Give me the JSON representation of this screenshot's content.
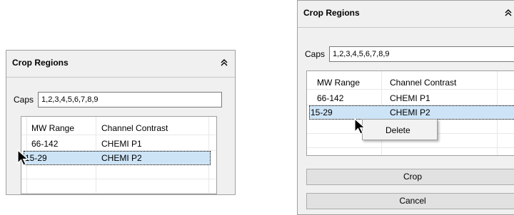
{
  "left_panel": {
    "title": "Crop Regions",
    "collapse_icon": "double-chevron-up-icon",
    "caps_label": "Caps",
    "caps_value": "1,2,3,4,5,6,7,8,9",
    "columns": [
      "MW Range",
      "Channel Contrast"
    ],
    "rows": [
      [
        "66-142",
        "CHEMI P1"
      ],
      [
        "15-29",
        "CHEMI P2"
      ]
    ],
    "selected_row": 1
  },
  "right_panel": {
    "title": "Crop Regions",
    "collapse_icon": "double-chevron-up-icon",
    "caps_label": "Caps",
    "caps_value": "1,2,3,4,5,6,7,8,9",
    "columns": [
      "MW Range",
      "Channel Contrast"
    ],
    "rows": [
      [
        "66-142",
        "CHEMI P1"
      ],
      [
        "15-29",
        "CHEMI P2"
      ]
    ],
    "selected_row": 1,
    "context_menu": {
      "items": [
        "Delete"
      ]
    },
    "crop_label": "Crop",
    "cancel_label": "Cancel"
  },
  "cursor_icon": "arrow-pointer-icon",
  "colors": {
    "selection": "#cde4f7",
    "panel_bg": "#f0f0f0",
    "button_bg": "#e1e1e1"
  }
}
